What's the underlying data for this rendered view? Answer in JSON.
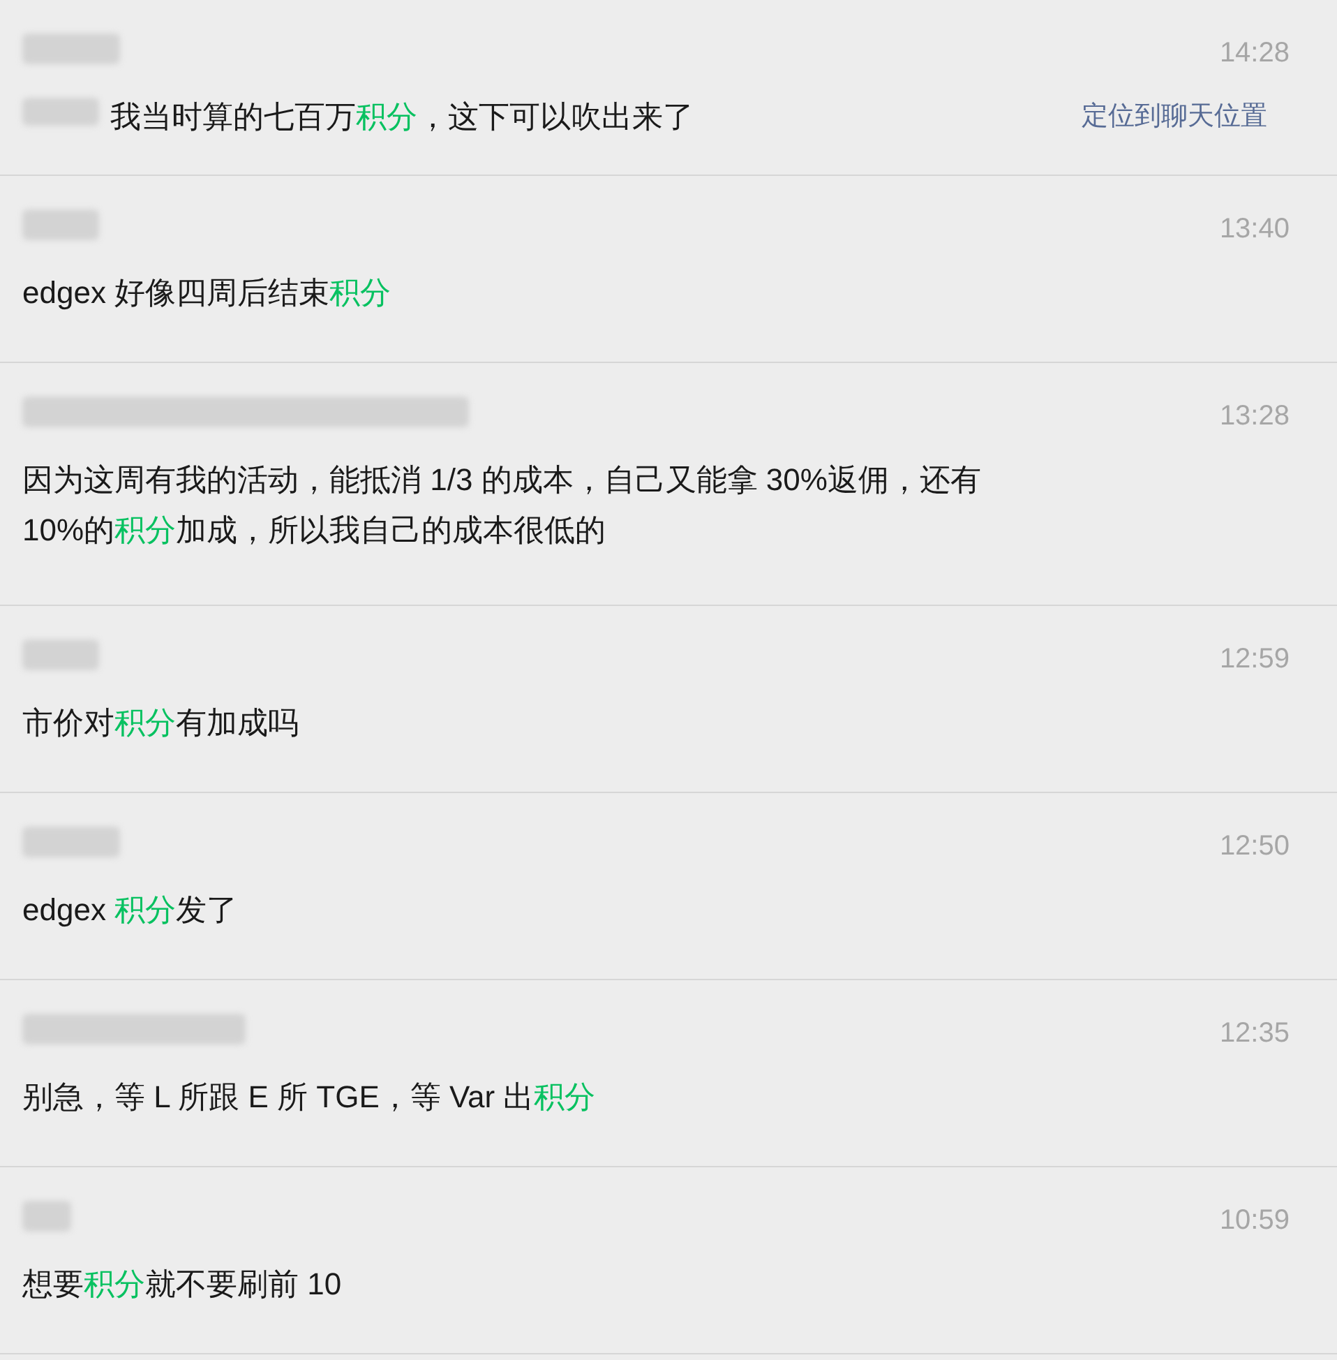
{
  "results": [
    {
      "time": "14:28",
      "message": [
        {
          "text": "我当时算的七百万",
          "highlighted": false
        },
        {
          "text": "积分",
          "highlighted": true
        },
        {
          "text": "，这下可以吹出来了",
          "highlighted": false
        }
      ],
      "locate_link": "定位到聊天位置",
      "message_prefix_blurred": true
    },
    {
      "time": "13:40",
      "message": [
        {
          "text": "edgex 好像四周后结束",
          "highlighted": false
        },
        {
          "text": "积分",
          "highlighted": true
        }
      ]
    },
    {
      "time": "13:28",
      "message": [
        {
          "text": "因为这周有我的活动，能抵消 1/3 的成本，自己又能拿 30%返佣，还有 10%的",
          "highlighted": false
        },
        {
          "text": "积分",
          "highlighted": true
        },
        {
          "text": "加成，所以我自己的成本很低的",
          "highlighted": false
        }
      ]
    },
    {
      "time": "12:59",
      "message": [
        {
          "text": "市价对",
          "highlighted": false
        },
        {
          "text": "积分",
          "highlighted": true
        },
        {
          "text": "有加成吗",
          "highlighted": false
        }
      ]
    },
    {
      "time": "12:50",
      "message": [
        {
          "text": "edgex ",
          "highlighted": false
        },
        {
          "text": "积分",
          "highlighted": true
        },
        {
          "text": "发了",
          "highlighted": false
        }
      ]
    },
    {
      "time": "12:35",
      "message": [
        {
          "text": "别急，等 L 所跟 E 所 TGE，等 Var 出",
          "highlighted": false
        },
        {
          "text": "积分",
          "highlighted": true
        }
      ]
    },
    {
      "time": "10:59",
      "message": [
        {
          "text": "想要",
          "highlighted": false
        },
        {
          "text": "积分",
          "highlighted": true
        },
        {
          "text": "就不要刷前 10",
          "highlighted": false
        }
      ]
    }
  ]
}
